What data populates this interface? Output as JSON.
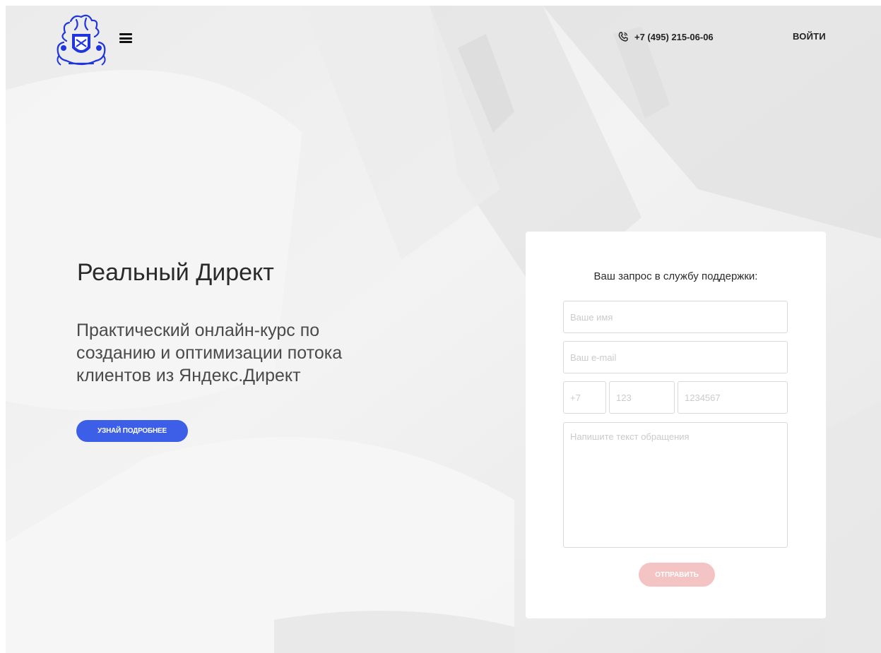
{
  "header": {
    "phone": "+7 (495) 215-06-06",
    "login_label": "ВОЙТИ"
  },
  "hero": {
    "title": "Реальный Директ",
    "subtitle": "Практический онлайн-курс по созданию и оптимизации потока клиентов из Яндекс.Директ",
    "cta_label": "УЗНАЙ ПОДРОБНЕЕ"
  },
  "form": {
    "title": "Ваш запрос в службу поддержки:",
    "name_placeholder": "Ваше имя",
    "email_placeholder": "Ваш e-mail",
    "phone_code_placeholder": "+7",
    "phone_area_placeholder": "123",
    "phone_number_placeholder": "1234567",
    "message_placeholder": "Напишите текст обращения",
    "submit_label": "ОТПРАВИТЬ"
  },
  "icons": {
    "logo": "heraldic-crest-logo",
    "menu": "hamburger-menu-icon",
    "phone": "phone-icon"
  },
  "colors": {
    "cta_blue": "#3d5fe8",
    "submit_pink": "#f4c4c4",
    "logo_blue": "#1f35e0"
  }
}
